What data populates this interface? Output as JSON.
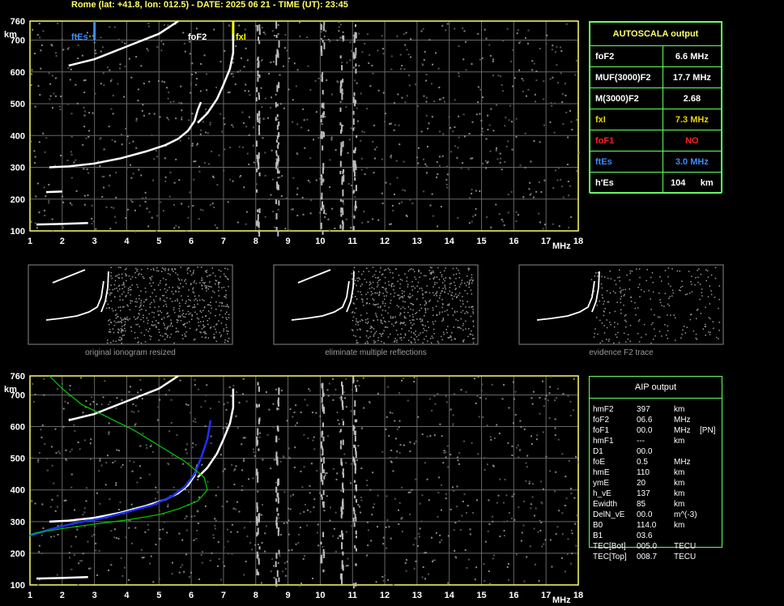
{
  "header": "Rome (lat: +41.8, lon: 012.5) - DATE: 2025 06 21 - TIME (UT): 23:45",
  "top_chart_labels": {
    "ftEs": "ftEs",
    "foF2": "foF2",
    "fxI": "fxI"
  },
  "autoscala": {
    "title": "AUTOSCALA output",
    "rows": [
      {
        "label": "foF2",
        "value": "6.6 MHz",
        "color": "#ffffff"
      },
      {
        "label": "MUF(3000)F2",
        "value": "17.7 MHz",
        "color": "#ffffff"
      },
      {
        "label": "M(3000)F2",
        "value": "2.68",
        "color": "#ffffff"
      },
      {
        "label": "fxI",
        "value": "7.3 MHz",
        "color": "#e6d400"
      },
      {
        "label": "foF1",
        "value": "NO",
        "color": "#ff2020"
      },
      {
        "label": "ftEs",
        "value": "3.0 MHz",
        "color": "#3a8cff"
      },
      {
        "label": "h'Es",
        "value": "104      km",
        "color": "#ffffff"
      }
    ]
  },
  "thumbnails": [
    {
      "caption": "original ionogram resized"
    },
    {
      "caption": "eliminate multiple reflections"
    },
    {
      "caption": "evidence F2 trace"
    }
  ],
  "aip": {
    "title": "AIP output",
    "rows": [
      {
        "name": "hmF2",
        "value": "397",
        "unit": "km",
        "extra": ""
      },
      {
        "name": "foF2",
        "value": "06.6",
        "unit": "MHz",
        "extra": ""
      },
      {
        "name": "foF1",
        "value": "00.0",
        "unit": "MHz",
        "extra": "[PN]"
      },
      {
        "name": "hmF1",
        "value": "---",
        "unit": "km",
        "extra": ""
      },
      {
        "name": "D1",
        "value": "00.0",
        "unit": "",
        "extra": ""
      },
      {
        "name": "foE",
        "value": "0.5",
        "unit": "MHz",
        "extra": ""
      },
      {
        "name": "hmE",
        "value": "110",
        "unit": "km",
        "extra": ""
      },
      {
        "name": "ymE",
        "value": "20",
        "unit": "km",
        "extra": ""
      },
      {
        "name": "h_vE",
        "value": "137",
        "unit": "km",
        "extra": ""
      },
      {
        "name": "Ewidth",
        "value": "85",
        "unit": "km",
        "extra": ""
      },
      {
        "name": "DelN_vE",
        "value": "00.0",
        "unit": "m^(-3)",
        "extra": ""
      },
      {
        "name": "B0",
        "value": "114.0",
        "unit": "km",
        "extra": ""
      },
      {
        "name": "B1",
        "value": "03.6",
        "unit": "",
        "extra": ""
      },
      {
        "name": "TEC[Bot]",
        "value": "005.0",
        "unit": "TECU",
        "extra": ""
      },
      {
        "name": "TEC[Top]",
        "value": "008.7",
        "unit": "TECU",
        "extra": ""
      }
    ]
  },
  "chart_data": [
    {
      "type": "scatter",
      "title": "",
      "xlabel": "MHz",
      "ylabel": "km",
      "xlim": [
        1,
        18
      ],
      "ylim": [
        100,
        760
      ],
      "x_ticks": [
        1,
        2,
        3,
        4,
        5,
        6,
        7,
        8,
        9,
        10,
        11,
        12,
        13,
        14,
        15,
        16,
        17,
        18
      ],
      "y_ticks": [
        100,
        200,
        300,
        400,
        500,
        600,
        700,
        760
      ],
      "grid": true,
      "markers": [
        {
          "name": "ftEs",
          "x": 3.0,
          "color": "#3a8cff"
        },
        {
          "name": "fxI",
          "x": 7.3,
          "color": "#ffff00"
        }
      ],
      "series": [
        {
          "color": "#ffffff",
          "points": [
            [
              1.6,
              300
            ],
            [
              2.2,
              303
            ],
            [
              3.0,
              312
            ],
            [
              3.8,
              328
            ],
            [
              4.6,
              350
            ],
            [
              5.2,
              370
            ],
            [
              5.6,
              390
            ],
            [
              5.9,
              415
            ],
            [
              6.1,
              445
            ],
            [
              6.2,
              480
            ],
            [
              6.3,
              505
            ]
          ]
        },
        {
          "color": "#ffffff",
          "points": [
            [
              6.2,
              440
            ],
            [
              6.5,
              470
            ],
            [
              6.8,
              515
            ],
            [
              7.0,
              560
            ],
            [
              7.2,
              610
            ],
            [
              7.3,
              660
            ],
            [
              7.3,
              720
            ]
          ]
        },
        {
          "color": "#ffffff",
          "points": [
            [
              2.2,
              620
            ],
            [
              3.0,
              640
            ],
            [
              4.0,
              680
            ],
            [
              5.0,
              720
            ],
            [
              5.6,
              760
            ]
          ]
        },
        {
          "color": "#ffffff",
          "points": [
            [
              1.2,
              120
            ],
            [
              2.0,
              122
            ],
            [
              2.8,
              125
            ]
          ]
        },
        {
          "color": "#ffffff",
          "points": [
            [
              1.5,
              222
            ],
            [
              2.0,
              224
            ]
          ]
        }
      ]
    },
    {
      "type": "scatter",
      "title": "",
      "xlabel": "MHz",
      "ylabel": "km",
      "xlim": [
        1,
        18
      ],
      "ylim": [
        100,
        760
      ],
      "x_ticks": [
        1,
        2,
        3,
        4,
        5,
        6,
        7,
        8,
        9,
        10,
        11,
        12,
        13,
        14,
        15,
        16,
        17,
        18
      ],
      "y_ticks": [
        100,
        200,
        300,
        400,
        500,
        600,
        700,
        760
      ],
      "grid": true,
      "series": [
        {
          "color": "#ffffff",
          "points": [
            [
              1.6,
              300
            ],
            [
              2.2,
              303
            ],
            [
              3.0,
              312
            ],
            [
              3.8,
              328
            ],
            [
              4.6,
              350
            ],
            [
              5.2,
              370
            ],
            [
              5.6,
              390
            ],
            [
              5.9,
              415
            ],
            [
              6.1,
              445
            ],
            [
              6.2,
              480
            ]
          ]
        },
        {
          "color": "#ffffff",
          "points": [
            [
              6.2,
              440
            ],
            [
              6.5,
              470
            ],
            [
              6.8,
              515
            ],
            [
              7.0,
              560
            ],
            [
              7.2,
              610
            ],
            [
              7.3,
              660
            ],
            [
              7.3,
              720
            ]
          ]
        },
        {
          "color": "#ffffff",
          "points": [
            [
              2.2,
              620
            ],
            [
              3.0,
              640
            ],
            [
              4.0,
              680
            ],
            [
              5.0,
              720
            ],
            [
              5.6,
              760
            ]
          ]
        },
        {
          "color": "#ffffff",
          "points": [
            [
              1.2,
              120
            ],
            [
              2.0,
              122
            ],
            [
              2.8,
              125
            ]
          ]
        },
        {
          "color": "#2030ff",
          "points": [
            [
              1.0,
              255
            ],
            [
              1.6,
              275
            ],
            [
              2.4,
              295
            ],
            [
              3.2,
              310
            ],
            [
              4.0,
              330
            ],
            [
              4.8,
              352
            ],
            [
              5.4,
              380
            ],
            [
              5.8,
              410
            ],
            [
              6.1,
              450
            ],
            [
              6.3,
              500
            ],
            [
              6.5,
              560
            ],
            [
              6.6,
              620
            ]
          ]
        },
        {
          "color": "#00cc00",
          "points": [
            [
              1.6,
              760
            ],
            [
              2.0,
              720
            ],
            [
              2.6,
              670
            ],
            [
              3.4,
              630
            ],
            [
              4.2,
              590
            ],
            [
              5.0,
              540
            ],
            [
              5.8,
              490
            ],
            [
              6.4,
              440
            ],
            [
              6.5,
              400
            ],
            [
              6.2,
              365
            ],
            [
              5.6,
              340
            ],
            [
              5.0,
              322
            ],
            [
              4.0,
              305
            ],
            [
              3.0,
              292
            ],
            [
              2.0,
              278
            ],
            [
              1.2,
              265
            ],
            [
              1.0,
              258
            ]
          ]
        }
      ]
    }
  ]
}
